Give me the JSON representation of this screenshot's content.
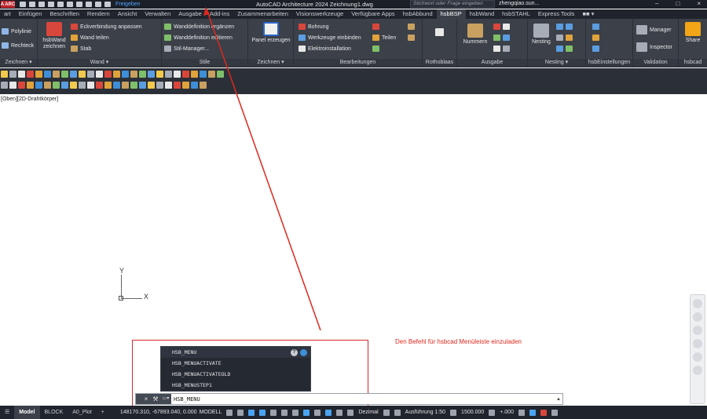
{
  "titlebar": {
    "logo": "A ARC",
    "share": "Freigeben",
    "app_title": "AutoCAD Architecture 2024   Zeichnung1.dwg",
    "search_placeholder": "Stichwort oder Frage eingeben",
    "user": "zhengqiao.sun...",
    "minimize": "–",
    "maximize": "□",
    "close": "×"
  },
  "tabs": [
    "art",
    "Einfügen",
    "Beschriften",
    "Rendern",
    "Ansicht",
    "Verwalten",
    "Ausgabe",
    "Add-ins",
    "Zusammenarbeiten",
    "Visionswerkzeuge",
    "Verfügbare Apps",
    "hsbAbbund",
    "hsbBSP",
    "hsbWand",
    "hsbSTAHL",
    "Express Tools",
    "■■ ▾"
  ],
  "active_tab": "hsbBSP",
  "ribbon": {
    "zeichnen": {
      "polylinie": "Polylinie",
      "rechteck": "Rechteck",
      "label": "Zeichnen ▾"
    },
    "wand": {
      "big": "hsbWand zeichnen",
      "eckverbindung": "Eckverbindung anpassen",
      "wand_teilen": "Wand teilen",
      "stab": "Stab",
      "label": "Wand ▾"
    },
    "stile": {
      "ergaenzen": "Wanddefinition ergänzen",
      "editieren": "Wanddefinition editieren",
      "manager": "Stil-Manager...",
      "label": "Stile"
    },
    "zeichnen2": {
      "panel": "Panel erzeugen",
      "label": "Zeichnen ▾"
    },
    "bearbeitungen": {
      "bohrung": "Bohrung",
      "werkzeuge": "Werkzeuge einbinden",
      "elektro": "Elektroinstallation",
      "teilen": "Teilen",
      "label": "Bearbeitungen"
    },
    "rothoblaas": {
      "label": "Rothoblaas"
    },
    "ausgabe": {
      "nummern": "Nummern",
      "label": "Ausgabe"
    },
    "nesting": {
      "big": "Nesting",
      "label": "Nesting ▾"
    },
    "einstellungen": {
      "label": "hsbEinstellungen"
    },
    "validation": {
      "manager": "Manager",
      "inspector": "Inspector",
      "label": "Validation"
    },
    "hsbcad": {
      "share": "Share",
      "label": "hsbcad"
    }
  },
  "viewport_label": "[Oben][2D-Drahtkörper]",
  "ucs": {
    "y": "Y",
    "x": "X"
  },
  "annotation": "Den Befehl für hsbcad Menüleiste einzuladen",
  "autocomplete": [
    "HSB_MENU",
    "HSB_MENUACTIVATE",
    "HSB_MENUACTIVATEOLD",
    "HSB_MENUSTEP1"
  ],
  "command": {
    "value": "HSB_MENU",
    "close": "×",
    "wrench": "🔧",
    "prompt": "▭▾"
  },
  "status": {
    "tabs": [
      "Model",
      "BLOCK",
      "A0_Plot",
      "+"
    ],
    "coords": "148170.310, -67893.040, 0.000",
    "mode": "MODELL",
    "units": "Dezimal",
    "detail": "Ausführung 1:50",
    "scale": "1500.000",
    "offset": "+.000"
  },
  "colors": {
    "annotation": "#e0281e",
    "frame": "#d8282c",
    "accent": "#4fa3ff"
  }
}
